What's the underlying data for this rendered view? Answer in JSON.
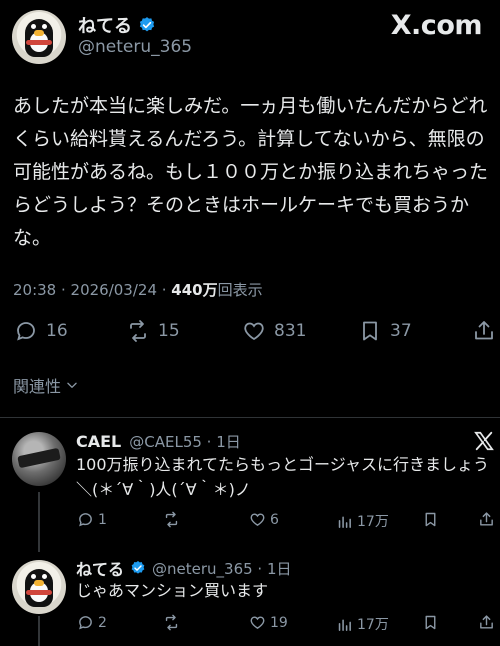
{
  "post": {
    "author_name": "ねてる",
    "author_handle": "@neteru_365",
    "site_logo": "X.com",
    "text": "あしたが本当に楽しみだ。一ヵ月も働いたんだからどれくらい給料貰えるんだろう。計算してないから、無限の可能性があるね。もし１００万とか振り込まれちゃったらどうしよう？そのときはホールケーキでも買おうかな。",
    "time": "20:38 · 2026/03/24 · ",
    "views_count": "440",
    "views_unit": "万",
    "views_label": "回表示",
    "actions": {
      "replies": "16",
      "reposts": "15",
      "likes": "831",
      "bookmarks": "37"
    },
    "related_label": "関連性"
  },
  "replies": [
    {
      "name": "CAEL",
      "handle": "@CAEL55 · 1日",
      "text": "100万振り込まれてたらもっとゴージャスに行きましょう＼(＊´∀｀)人(´∀｀＊)ノ",
      "replies": "1",
      "reposts": "",
      "likes": "6",
      "views": "17万"
    },
    {
      "name": "ねてる",
      "handle": "@neteru_365 · 1日",
      "text": "じゃあマンション買います",
      "replies": "2",
      "reposts": "",
      "likes": "19",
      "views": "17万"
    }
  ],
  "colors": {
    "accent_blue": "#1d9bf0",
    "muted": "#8b98a5",
    "background": "#000000"
  }
}
